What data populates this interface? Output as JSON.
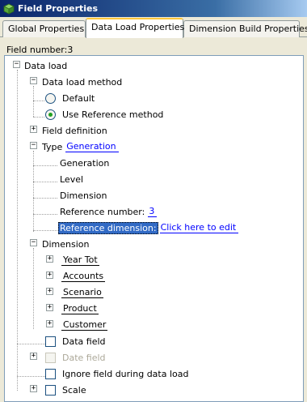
{
  "window": {
    "title": "Field Properties",
    "accent_color": "#0a246a"
  },
  "tabs": [
    {
      "label": "Global Properties",
      "active": false
    },
    {
      "label": "Data Load Properties",
      "active": true
    },
    {
      "label": "Dimension Build Properties",
      "active": false
    }
  ],
  "field_number_label": "Field number:3",
  "tree": {
    "root": "Data load",
    "data_load_method": {
      "label": "Data load method",
      "options": [
        {
          "label": "Default",
          "checked": false
        },
        {
          "label": "Use Reference method",
          "checked": true
        }
      ]
    },
    "field_definition": "Field definition",
    "type": {
      "label": "Type",
      "value": "Generation",
      "children": [
        "Generation",
        "Level",
        "Dimension"
      ],
      "reference_number_label": "Reference number:",
      "reference_number_value": "3",
      "reference_dimension_label": "Reference dimension:",
      "reference_dimension_value": "Click here to edit"
    },
    "dimension": {
      "label": "Dimension",
      "items": [
        "Year Tot",
        "Accounts",
        "Scenario",
        "Product",
        "Customer"
      ]
    },
    "data_field": "Data field",
    "date_field": "Date field",
    "ignore_field": "Ignore field during data load",
    "scale": "Scale"
  }
}
